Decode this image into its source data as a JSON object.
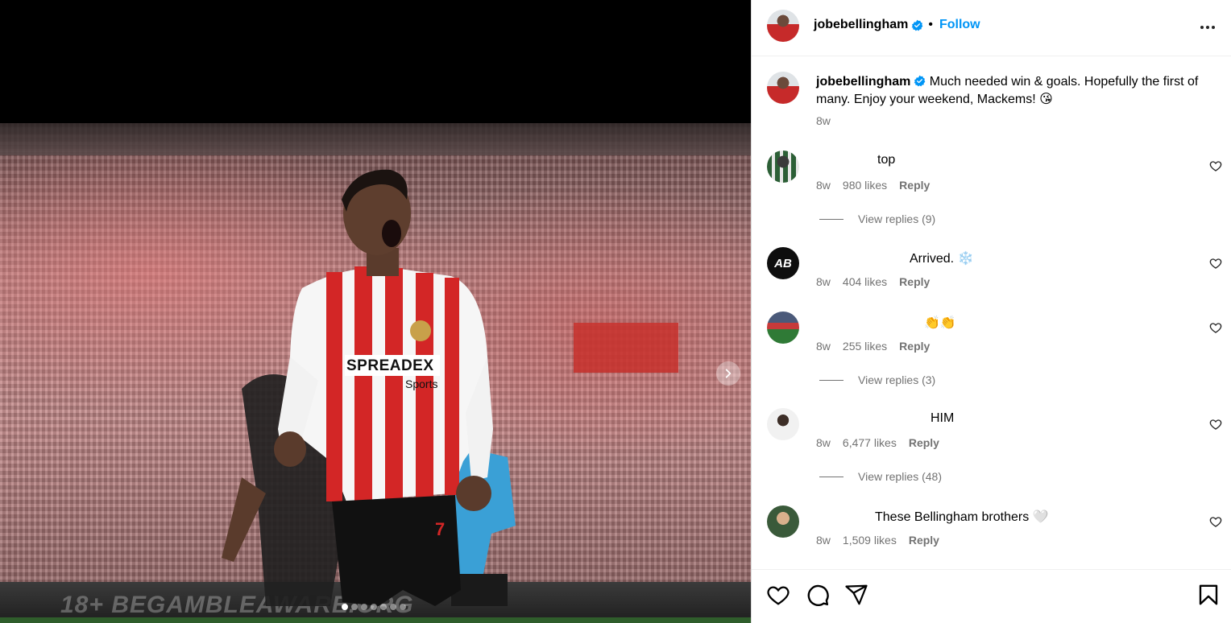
{
  "post": {
    "username": "jobebellingham",
    "follow_label": "Follow",
    "separator": "•",
    "caption": "Much needed win & goals. Hopefully the first of many. Enjoy your weekend, Mackems!",
    "caption_emoji": "😘",
    "caption_time": "8w"
  },
  "media": {
    "ad_board_text": "18+ BEGAMBLEAWARE.ORG",
    "shirt_sponsor": "SPREADEX",
    "shirt_sponsor_sub": "Sports",
    "shirt_number": "7",
    "carousel_total": 7,
    "carousel_active": 1
  },
  "comments": [
    {
      "text": "top",
      "time": "8w",
      "likes": "980 likes",
      "reply": "Reply",
      "view_replies": "View replies (9)"
    },
    {
      "text": "Arrived. ❄️",
      "time": "8w",
      "likes": "404 likes",
      "reply": "Reply",
      "view_replies": ""
    },
    {
      "text": "👏👏",
      "time": "8w",
      "likes": "255 likes",
      "reply": "Reply",
      "view_replies": "View replies (3)"
    },
    {
      "text": "HIM",
      "time": "8w",
      "likes": "6,477 likes",
      "reply": "Reply",
      "view_replies": "View replies (48)"
    },
    {
      "text": "These Bellingham brothers 🤍",
      "time": "8w",
      "likes": "1,509 likes",
      "reply": "Reply",
      "view_replies": ""
    }
  ],
  "avatar_badge_text": "AB",
  "colors": {
    "accent": "#0095f6",
    "muted": "#737373",
    "verified": "#0095f6"
  },
  "icons": [
    "verified-badge-icon",
    "more-options-icon",
    "heart-icon",
    "comment-icon",
    "share-icon",
    "bookmark-icon",
    "chevron-right-icon"
  ]
}
